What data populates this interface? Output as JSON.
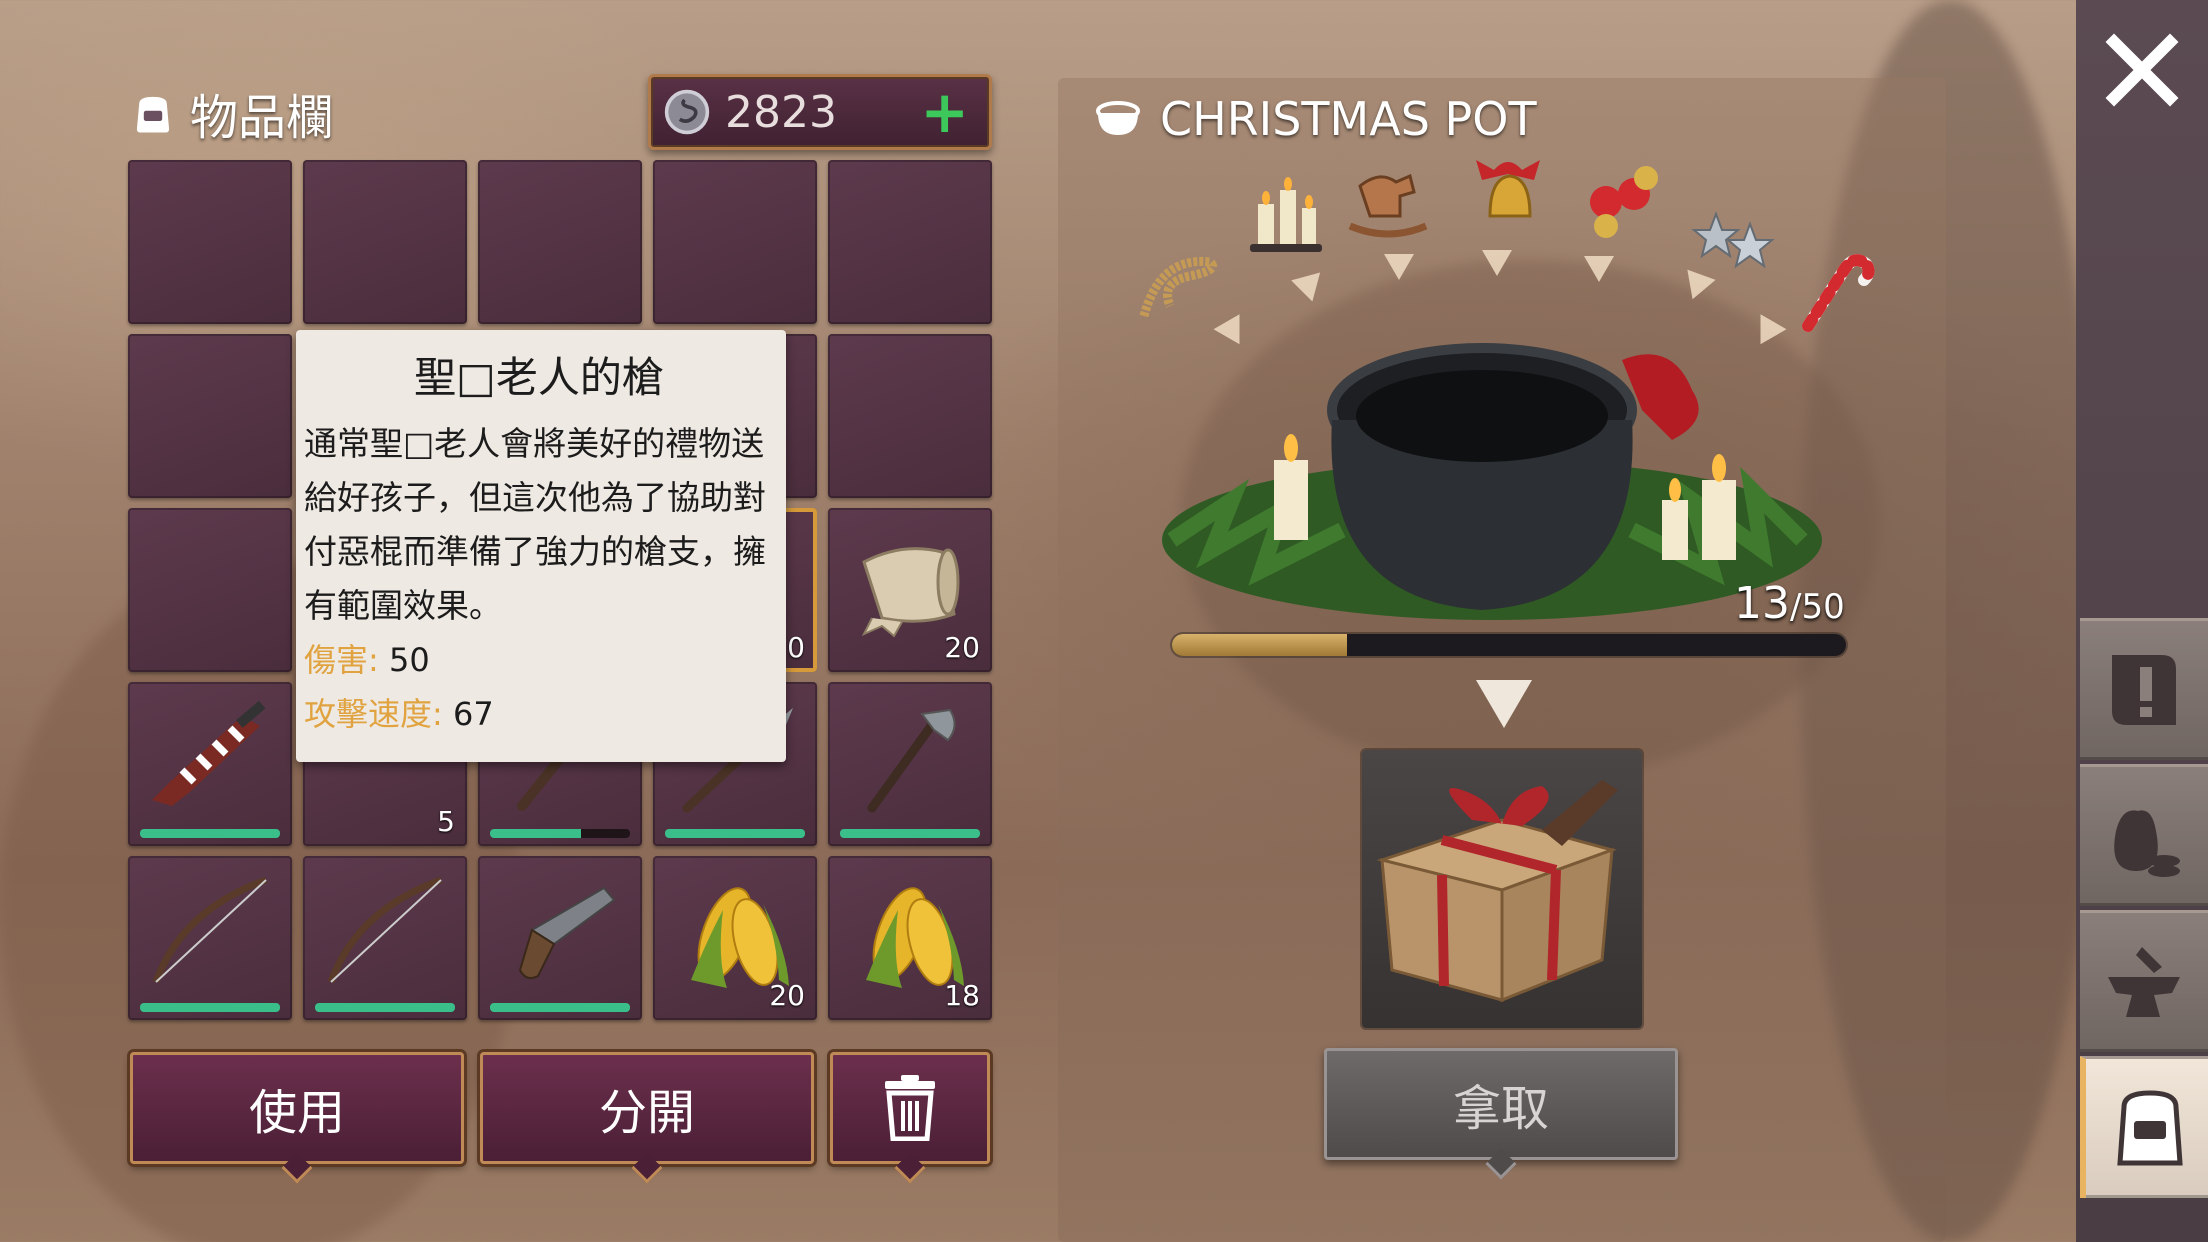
{
  "inventory": {
    "title": "物品欄",
    "coins": "2823",
    "add_coins_label": "+",
    "slots": [
      {
        "item": "",
        "count": ""
      },
      {
        "item": "",
        "count": ""
      },
      {
        "item": "",
        "count": ""
      },
      {
        "item": "",
        "count": ""
      },
      {
        "item": "",
        "count": ""
      },
      {
        "item": "",
        "count": ""
      },
      {
        "item": "hidden",
        "count": ""
      },
      {
        "item": "hidden",
        "count": ""
      },
      {
        "item": "hidden",
        "count": ""
      },
      {
        "item": "",
        "count": ""
      },
      {
        "item": "hidden",
        "count": ""
      },
      {
        "item": "hidden",
        "count": ""
      },
      {
        "item": "hidden",
        "count": ""
      },
      {
        "item": "hidden",
        "count": "0"
      },
      {
        "item": "cloth-icon",
        "count": "20"
      },
      {
        "item": "santa-gun-icon",
        "count": "",
        "durability": 0.9
      },
      {
        "item": "paper-icon",
        "count": "5"
      },
      {
        "item": "stick-icon",
        "count": "",
        "durability": 0.6
      },
      {
        "item": "spear-icon",
        "count": "",
        "durability": 0.95
      },
      {
        "item": "axe-icon",
        "count": "",
        "durability": 0.95
      },
      {
        "item": "bow-icon",
        "count": "",
        "durability": 0.95
      },
      {
        "item": "bow-icon",
        "count": "",
        "durability": 0.95
      },
      {
        "item": "pistol-icon",
        "count": "",
        "durability": 0.95
      },
      {
        "item": "corn-icon",
        "count": "20"
      },
      {
        "item": "corn-icon",
        "count": "18"
      }
    ],
    "tooltip": {
      "title": "聖□老人的槍",
      "description": "通常聖□老人會將美好的禮物送給好孩子，但這次他為了協助對付惡棍而準備了強力的槍支，擁有範圍效果。",
      "damage_label": "傷害:",
      "damage_value": "50",
      "speed_label": "攻擊速度:",
      "speed_value": "67"
    },
    "buttons": {
      "use": "使用",
      "split": "分開",
      "trash_icon": "trash-icon"
    }
  },
  "christmas_pot": {
    "title": "CHRISTMAS POT",
    "ingredients": [
      "rope-icon",
      "candles-icon",
      "rocking-horse-icon",
      "bell-icon",
      "ornaments-icon",
      "stars-icon",
      "candy-cane-icon"
    ],
    "progress_current": "13",
    "progress_total": "/50",
    "progress_fraction": 0.26,
    "reward_icon": "gift-box-icon",
    "take_label": "拿取"
  },
  "sidebar": {
    "close_icon": "close-icon",
    "tabs": [
      "quest-icon",
      "trade-icon",
      "craft-anvil-icon",
      "backpack-icon"
    ]
  },
  "colors": {
    "accent": "#bf8a55",
    "button": "#6b2f4c",
    "damage_label": "#e0a340",
    "plus": "#3cc85a",
    "durability": "#3bbf8a"
  }
}
